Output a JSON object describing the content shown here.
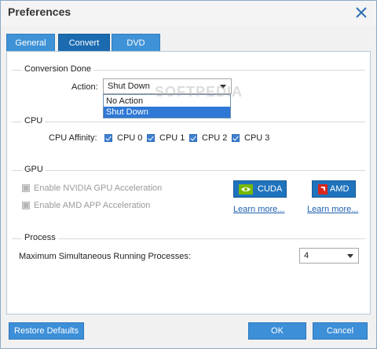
{
  "window": {
    "title": "Preferences"
  },
  "tabs": [
    {
      "label": "General",
      "active": false
    },
    {
      "label": "Convert",
      "active": true
    },
    {
      "label": "DVD",
      "active": false
    }
  ],
  "conversion": {
    "section_title": "Conversion Done",
    "action_label": "Action:",
    "action_value": "Shut Down",
    "options": [
      "No Action",
      "Shut Down"
    ],
    "selected_option": "Shut Down"
  },
  "cpu": {
    "section_title": "CPU",
    "affinity_label": "CPU Affinity:",
    "cores": [
      {
        "label": "CPU 0",
        "checked": true
      },
      {
        "label": "CPU 1",
        "checked": true
      },
      {
        "label": "CPU 2",
        "checked": true
      },
      {
        "label": "CPU 3",
        "checked": true
      }
    ]
  },
  "gpu": {
    "section_title": "GPU",
    "nvidia_label": "Enable NVIDIA GPU Acceleration",
    "amd_label": "Enable AMD APP Acceleration",
    "cuda_button": "CUDA",
    "amd_button": "AMD",
    "learn_more_cuda": "Learn more...",
    "learn_more_amd": "Learn more..."
  },
  "process": {
    "section_title": "Process",
    "max_label": "Maximum Simultaneous Running Processes:",
    "max_value": "4"
  },
  "footer": {
    "restore_label": "Restore Defaults",
    "ok_label": "OK",
    "cancel_label": "Cancel"
  },
  "watermark": "SOFTPEDIA",
  "colors": {
    "accent": "#1c6bb0",
    "button": "#3d8fd8",
    "link": "#2060b0"
  }
}
